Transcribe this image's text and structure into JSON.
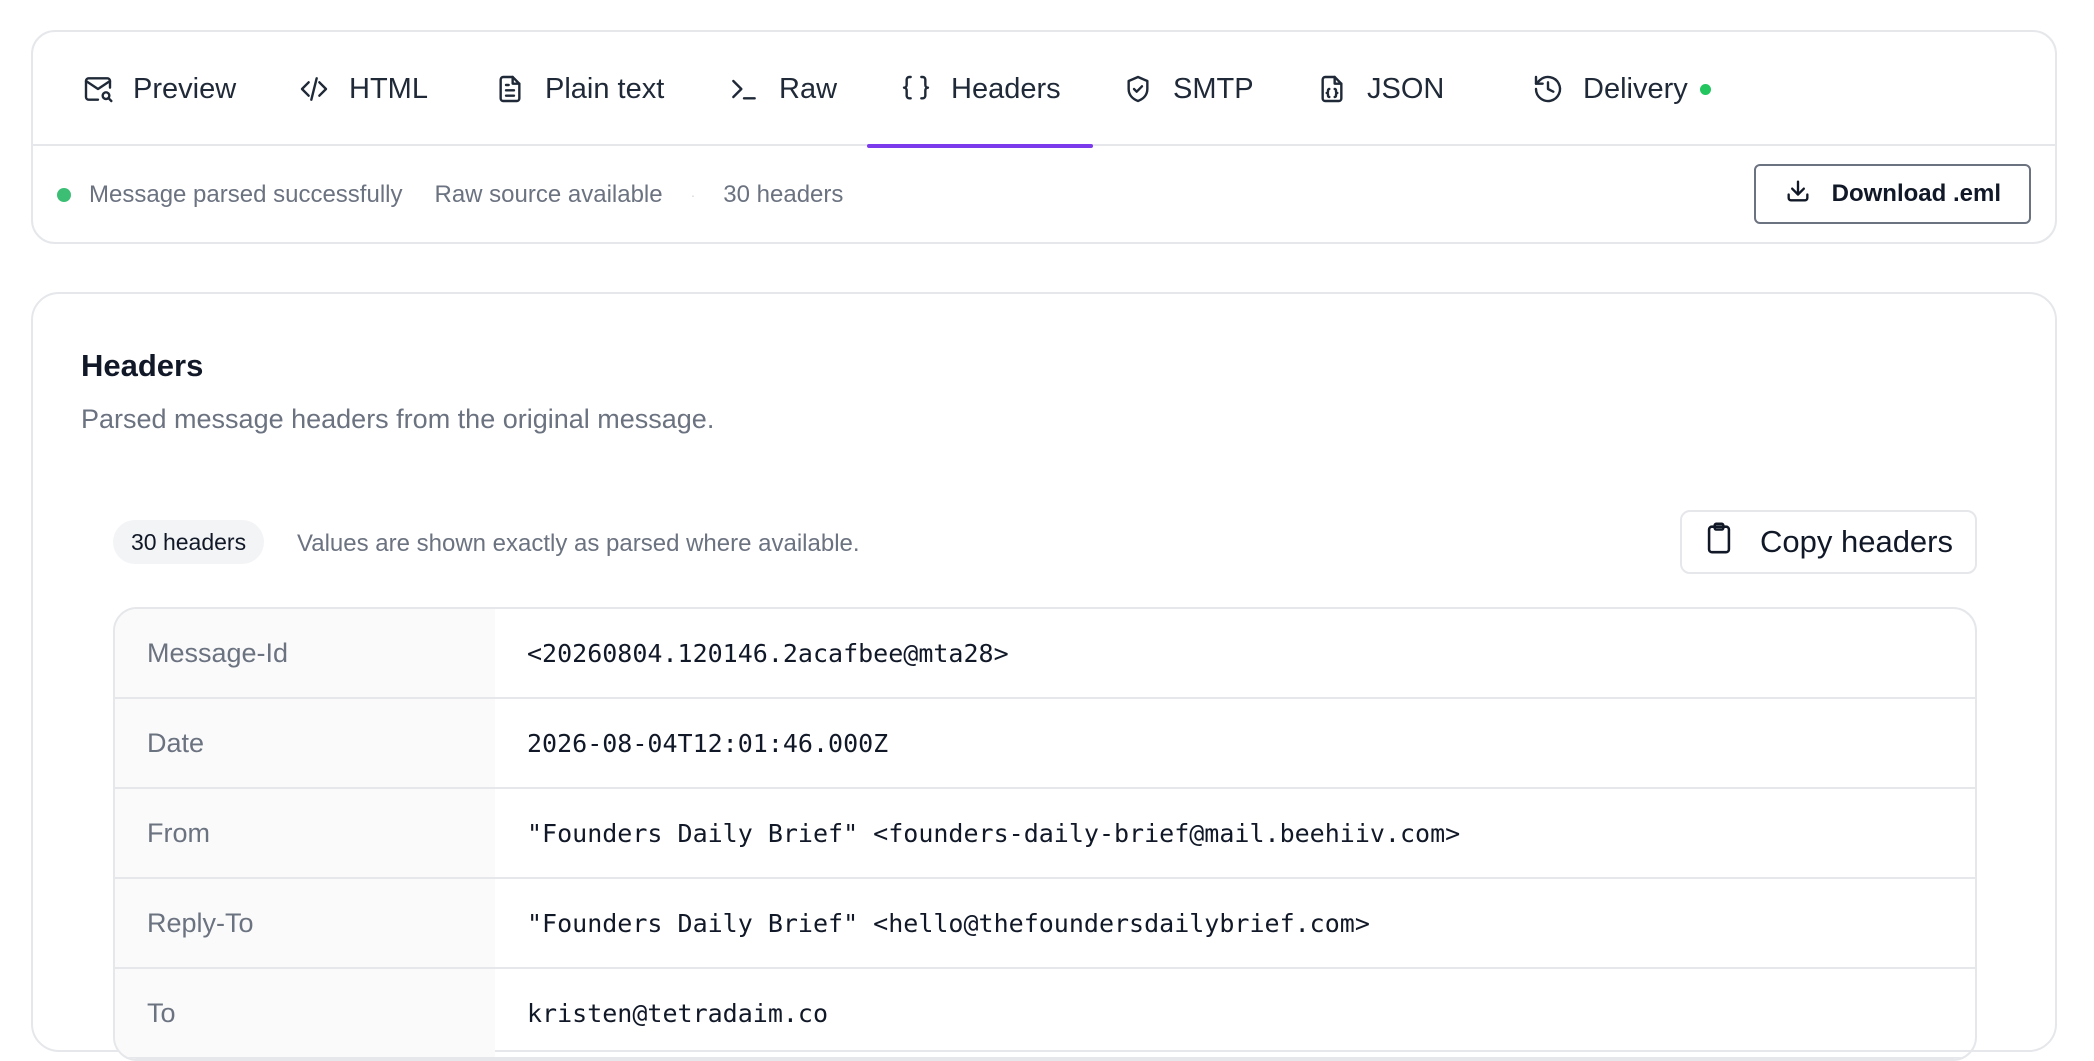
{
  "tabs": [
    {
      "label": "Preview",
      "icon": "mail-search-icon"
    },
    {
      "label": "HTML",
      "icon": "code-icon"
    },
    {
      "label": "Plain text",
      "icon": "file-text-icon"
    },
    {
      "label": "Raw",
      "icon": "terminal-icon"
    },
    {
      "label": "Headers",
      "icon": "braces-icon",
      "active": true
    },
    {
      "label": "SMTP",
      "icon": "shield-check-icon"
    },
    {
      "label": "JSON",
      "icon": "file-json-icon"
    },
    {
      "label": "Delivery",
      "icon": "history-icon",
      "status_dot": true
    }
  ],
  "status": {
    "parsed": "Message parsed successfully",
    "raw_source": "Raw source available",
    "separator": "·",
    "header_count": "30 headers",
    "download_label": "Download .eml",
    "dot_color": "#3cbf74"
  },
  "headers_section": {
    "title": "Headers",
    "subtitle": "Parsed message headers from the original message.",
    "count_badge": "30 headers",
    "note": "Values are shown exactly as parsed where available.",
    "copy_label": "Copy headers",
    "rows": [
      {
        "key": "Message-Id",
        "value": "<20260804.120146.2acafbee@mta28>"
      },
      {
        "key": "Date",
        "value": "2026-08-04T12:01:46.000Z"
      },
      {
        "key": "From",
        "value": "\"Founders Daily Brief\" <founders-daily-brief@mail.beehiiv.com>"
      },
      {
        "key": "Reply-To",
        "value": "\"Founders Daily Brief\" <hello@thefoundersdailybrief.com>"
      },
      {
        "key": "To",
        "value": "kristen@tetradaim.co"
      }
    ]
  },
  "accent_color": "#7c3aed"
}
